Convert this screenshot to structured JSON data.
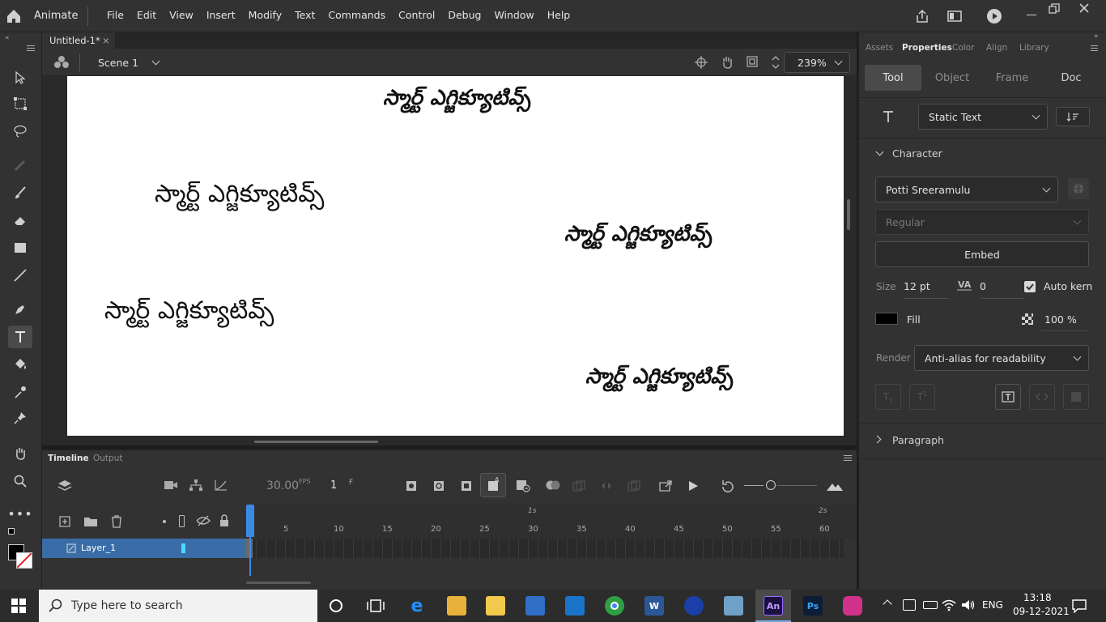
{
  "menubar": {
    "app_name": "Animate",
    "items": [
      "File",
      "Edit",
      "View",
      "Insert",
      "Modify",
      "Text",
      "Commands",
      "Control",
      "Debug",
      "Window",
      "Help"
    ]
  },
  "doc_tab": {
    "title": "Untitled-1*"
  },
  "scene": {
    "name": "Scene 1",
    "zoom": "239%"
  },
  "stage": {
    "texts": [
      "స్మార్ట్ ఎగ్జిక్యూటివ్స్",
      "స్మార్ట్ ఎగ్జిక్యూటివ్స్",
      "స్మార్ట్ ఎగ్జిక్యూటివ్స్",
      "స్మార్ట్ ఎగ్జిక్యూటివ్స్",
      "స్మార్ట్ ఎగ్జిక్యూటివ్స్"
    ]
  },
  "timeline": {
    "tabs": [
      "Timeline",
      "Output"
    ],
    "fps": "30.00",
    "fps_unit": "FPS",
    "frame": "1",
    "frame_unit": "F",
    "layer_name": "Layer_1",
    "seconds": [
      "1s",
      "2s"
    ],
    "frame_numbers": [
      "5",
      "10",
      "15",
      "20",
      "25",
      "30",
      "35",
      "40",
      "45",
      "50",
      "55",
      "60"
    ]
  },
  "panel": {
    "tabs": [
      "Assets",
      "Properties",
      "Color",
      "Align",
      "Library"
    ],
    "subtabs": [
      "Tool",
      "Object",
      "Frame",
      "Doc"
    ],
    "text_type": "Static Text",
    "character_label": "Character",
    "font_family": "Potti Sreeramulu",
    "font_style": "Regular",
    "embed_label": "Embed",
    "size_label": "Size",
    "size_value": "12 pt",
    "tracking_value": "0",
    "autokern_label": "Auto kern",
    "fill_label": "Fill",
    "fill_color": "#000000",
    "opacity": "100 %",
    "render_label": "Render",
    "render_value": "Anti-alias for readability",
    "paragraph_label": "Paragraph"
  },
  "taskbar": {
    "search_placeholder": "Type here to search",
    "language": "ENG",
    "time": "13:18",
    "date": "09-12-2021",
    "apps": [
      "An",
      "Ps"
    ]
  },
  "colors": {
    "accent": "#2d6fc7",
    "layer_bg": "#3a6da8",
    "playhead": "#3b8ae6"
  }
}
